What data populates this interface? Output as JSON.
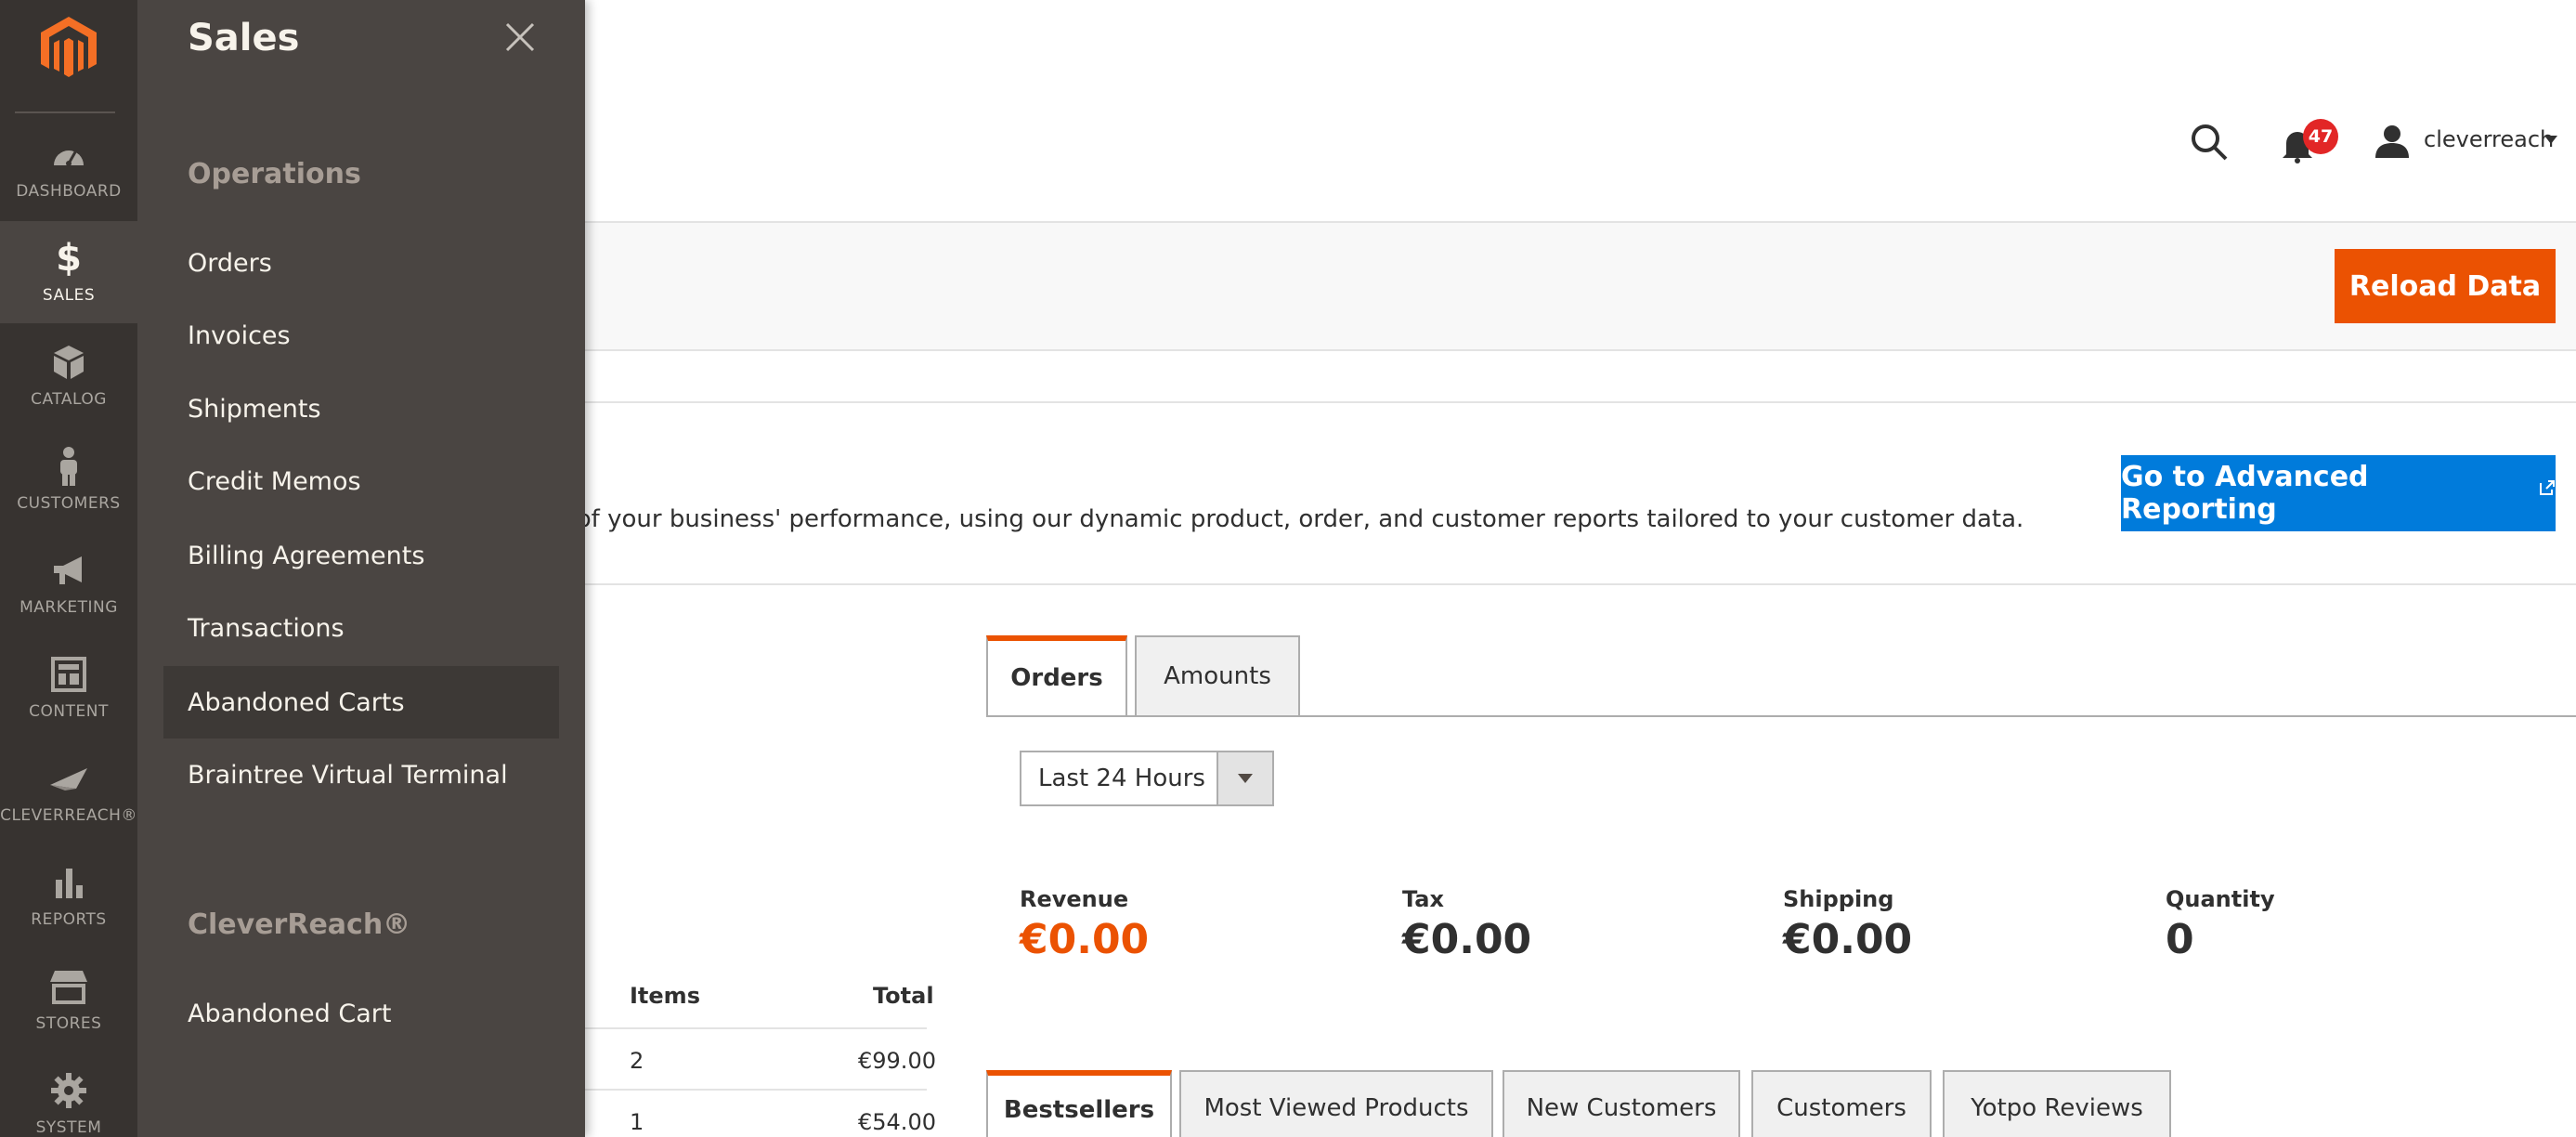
{
  "colors": {
    "nav_bg": "#373330",
    "flyout_bg": "#4a4542",
    "accent_orange": "#eb5202",
    "reporting_blue": "#007bdb",
    "badge_red": "#e22626"
  },
  "nav": {
    "logo_icon": "magento-logo-icon",
    "items": [
      {
        "label": "DASHBOARD",
        "icon": "dashboard-gauge-icon"
      },
      {
        "label": "SALES",
        "icon": "dollar-icon",
        "active": true
      },
      {
        "label": "CATALOG",
        "icon": "cube-icon"
      },
      {
        "label": "CUSTOMERS",
        "icon": "person-icon"
      },
      {
        "label": "MARKETING",
        "icon": "megaphone-icon"
      },
      {
        "label": "CONTENT",
        "icon": "layout-icon"
      },
      {
        "label": "CLEVERREACH®",
        "icon": "paper-plane-icon"
      },
      {
        "label": "REPORTS",
        "icon": "bar-chart-icon"
      },
      {
        "label": "STORES",
        "icon": "store-icon"
      },
      {
        "label": "SYSTEM",
        "icon": "gear-icon"
      }
    ]
  },
  "flyout": {
    "title": "Sales",
    "close_icon": "close-icon",
    "sections": [
      {
        "title": "Operations",
        "items": [
          "Orders",
          "Invoices",
          "Shipments",
          "Credit Memos",
          "Billing Agreements",
          "Transactions",
          "Abandoned Carts",
          "Braintree Virtual Terminal"
        ]
      },
      {
        "title": "CleverReach®",
        "items": [
          "Abandoned Cart"
        ]
      }
    ],
    "hovered_item": "Abandoned Carts"
  },
  "header": {
    "search_icon": "search-icon",
    "bell_icon": "bell-icon",
    "notification_count": "47",
    "user_icon": "user-icon",
    "username": "cleverreach"
  },
  "actions": {
    "reload_label": "Reload Data"
  },
  "advanced_reporting": {
    "text": "d of your business' performance, using our dynamic product, order, and customer reports tailored to your customer data.",
    "button_label": "Go to Advanced Reporting",
    "external_icon": "external-link-icon"
  },
  "chart_tabs": [
    {
      "label": "Orders",
      "active": true
    },
    {
      "label": "Amounts",
      "active": false
    }
  ],
  "period_select": {
    "value": "Last 24 Hours"
  },
  "totals": [
    {
      "label": "Revenue",
      "value": "€0.00",
      "accent": true
    },
    {
      "label": "Tax",
      "value": "€0.00"
    },
    {
      "label": "Shipping",
      "value": "€0.00"
    },
    {
      "label": "Quantity",
      "value": "0"
    }
  ],
  "last_orders": {
    "headers": [
      "Items",
      "Total"
    ],
    "rows": [
      {
        "items": "2",
        "total": "€99.00"
      },
      {
        "items": "1",
        "total": "€54.00"
      }
    ]
  },
  "bottom_tabs": [
    {
      "label": "Bestsellers",
      "active": true
    },
    {
      "label": "Most Viewed Products"
    },
    {
      "label": "New Customers"
    },
    {
      "label": "Customers"
    },
    {
      "label": "Yotpo Reviews"
    }
  ]
}
